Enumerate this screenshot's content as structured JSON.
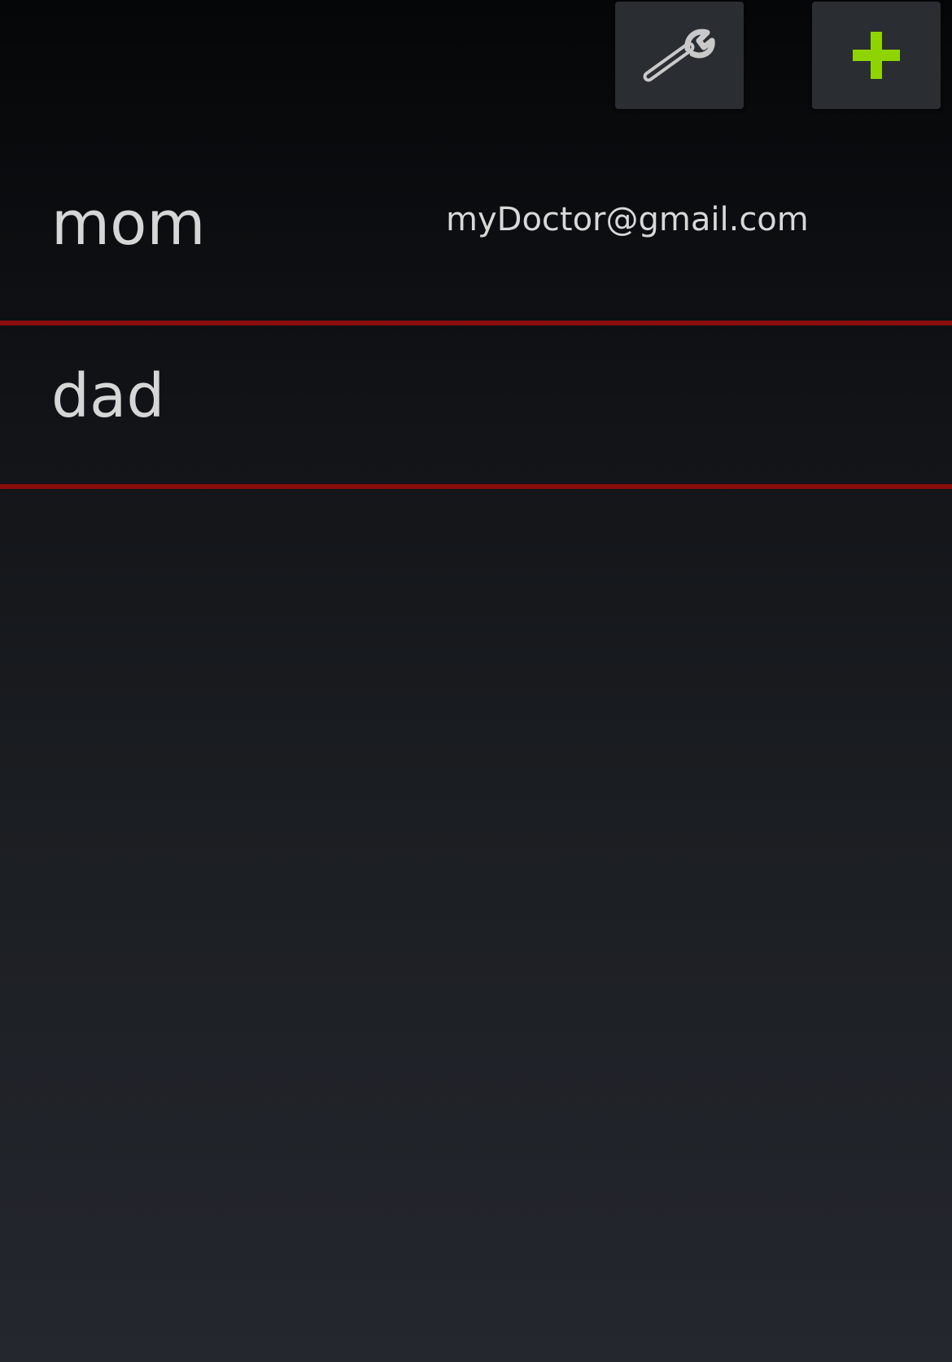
{
  "toolbar": {
    "settings_icon": "wrench-icon",
    "add_icon": "plus-icon",
    "add_icon_color": "#8fd400"
  },
  "divider_color": "#8a0c0c",
  "contacts": [
    {
      "name": "mom",
      "email": "myDoctor@gmail.com"
    },
    {
      "name": "dad",
      "email": ""
    }
  ]
}
